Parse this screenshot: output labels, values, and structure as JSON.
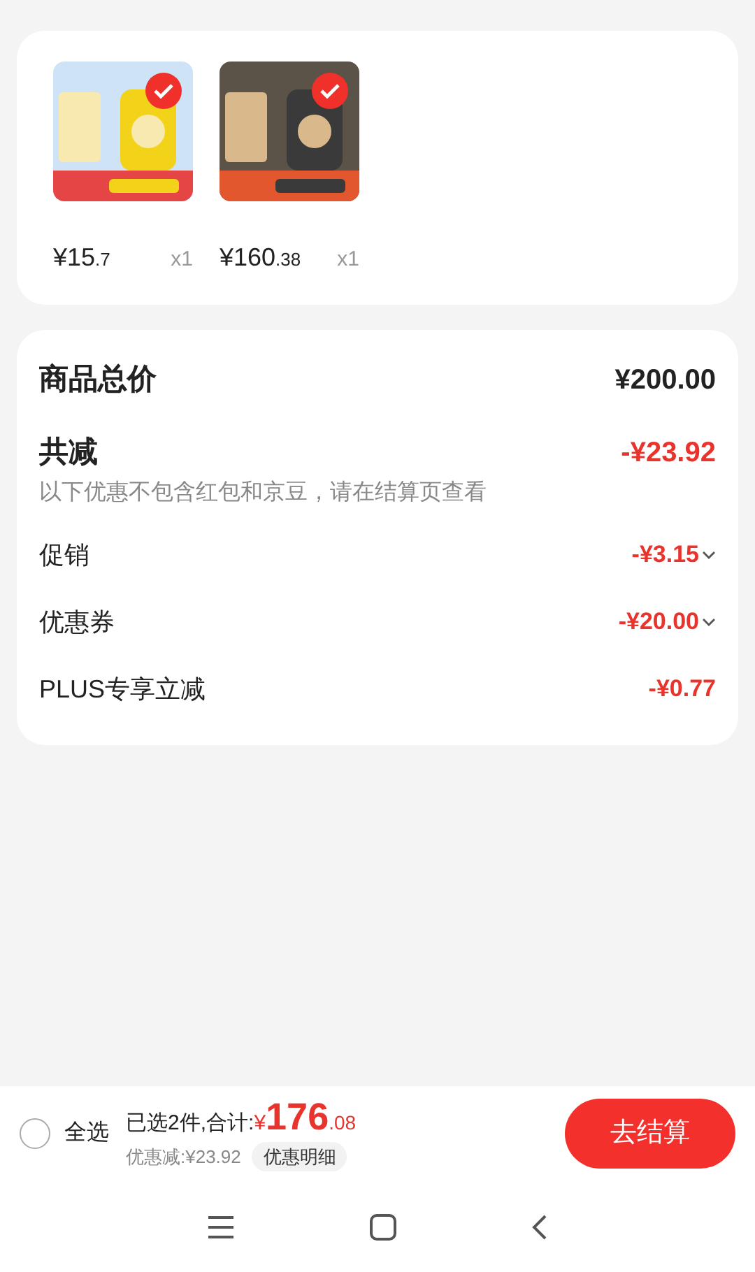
{
  "products": [
    {
      "checked": true,
      "price": {
        "yuan": "¥15",
        "fraction": ".7"
      },
      "quantity": "x1"
    },
    {
      "checked": true,
      "price": {
        "yuan": "¥160",
        "fraction": ".38"
      },
      "quantity": "x1"
    }
  ],
  "summary": {
    "total": {
      "label": "商品总价",
      "value": "¥200.00"
    },
    "reduction": {
      "label": "共减",
      "value": "-¥23.92",
      "note": "以下优惠不包含红包和京豆，请在结算页查看"
    },
    "discounts": [
      {
        "label": "促销",
        "value": "-¥3.15",
        "expandable": true
      },
      {
        "label": "优惠券",
        "value": "-¥20.00",
        "expandable": true
      },
      {
        "label": "PLUS专享立减",
        "value": "-¥0.77",
        "expandable": false
      }
    ]
  },
  "footer": {
    "select_all": {
      "label": "全选",
      "checked": false
    },
    "selected_text": "已选2件,合计:",
    "total": {
      "currency": "¥",
      "yuan": "176",
      "fraction": ".08"
    },
    "discount_text": "优惠减:¥23.92",
    "detail_button": "优惠明细",
    "checkout_button": "去结算"
  }
}
